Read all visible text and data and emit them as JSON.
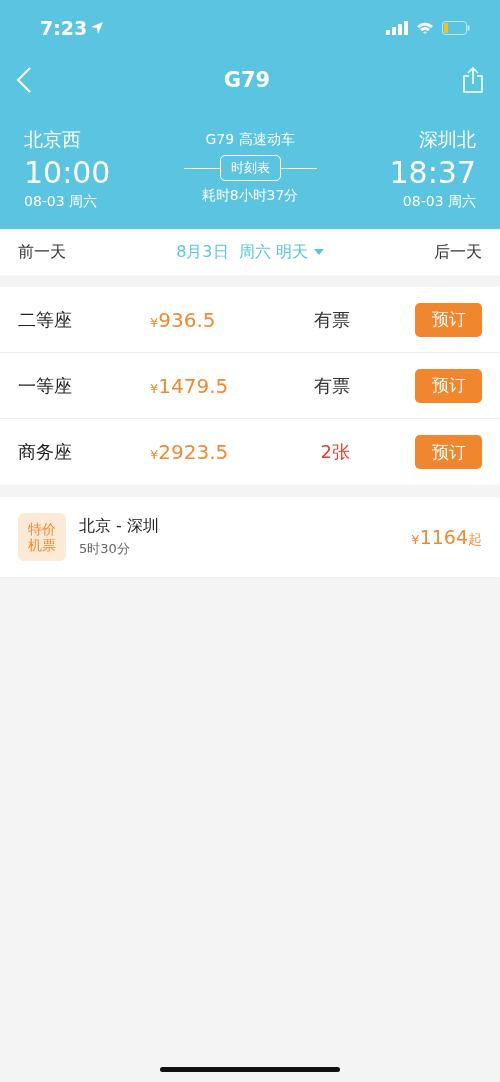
{
  "status_bar": {
    "time": "7:23"
  },
  "nav": {
    "title": "G79"
  },
  "journey": {
    "from": {
      "station": "北京西",
      "time": "10:00",
      "date": "08-03 周六"
    },
    "train": "G79 高速动车",
    "timetable_button": "时刻表",
    "duration": "耗时8小时37分",
    "to": {
      "station": "深圳北",
      "time": "18:37",
      "date": "08-03 周六"
    }
  },
  "date_bar": {
    "prev": "前一天",
    "current": "8月3日  周六 明天",
    "next": "后一天"
  },
  "seats": [
    {
      "class": "二等座",
      "currency": "¥",
      "price": "936.5",
      "availability": "有票",
      "kind": "available",
      "button": "预订"
    },
    {
      "class": "一等座",
      "currency": "¥",
      "price": "1479.5",
      "availability": "有票",
      "kind": "available",
      "button": "预订"
    },
    {
      "class": "商务座",
      "currency": "¥",
      "price": "2923.5",
      "availability": "2张",
      "kind": "limited",
      "button": "预订"
    }
  ],
  "flight_offer": {
    "badge": "特价机票",
    "route": "北京 - 深圳",
    "duration": "5时30分",
    "currency": "¥",
    "price": "1164",
    "suffix": "起"
  }
}
